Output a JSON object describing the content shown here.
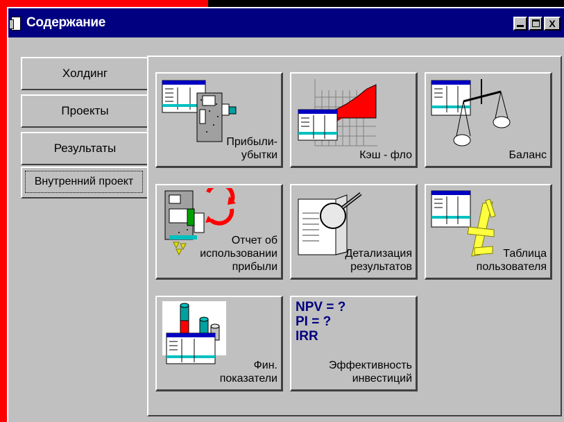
{
  "window": {
    "title": "Содержание",
    "close_label": "X"
  },
  "tabs": [
    {
      "label": "Холдинг"
    },
    {
      "label": "Проекты"
    },
    {
      "label": "Результаты"
    },
    {
      "label": "Внутренний проект",
      "active": true
    }
  ],
  "tiles": [
    {
      "label": "Прибыли-\nубытки",
      "icon": "profit-loss-icon"
    },
    {
      "label": "Кэш - фло",
      "icon": "cash-flow-icon"
    },
    {
      "label": "Баланс",
      "icon": "balance-scale-icon"
    },
    {
      "label": "Отчет об\nиспользовании\nприбыли",
      "icon": "profit-usage-report-icon"
    },
    {
      "label": "Детализация\nрезультатов",
      "icon": "magnifier-book-icon"
    },
    {
      "label": "Таблица\nпользователя",
      "icon": "user-table-icon"
    },
    {
      "label": "Фин.\nпоказатели",
      "icon": "financial-indicators-icon"
    },
    {
      "label": "Эффективность\nинвестиций",
      "icon": "investment-efficiency-icon",
      "formula_lines": [
        "NPV = ?",
        "PI = ?",
        "IRR"
      ]
    }
  ],
  "colors": {
    "titlebar": "#000080",
    "face": "#c0c0c0",
    "accent_red": "#ff0000"
  }
}
